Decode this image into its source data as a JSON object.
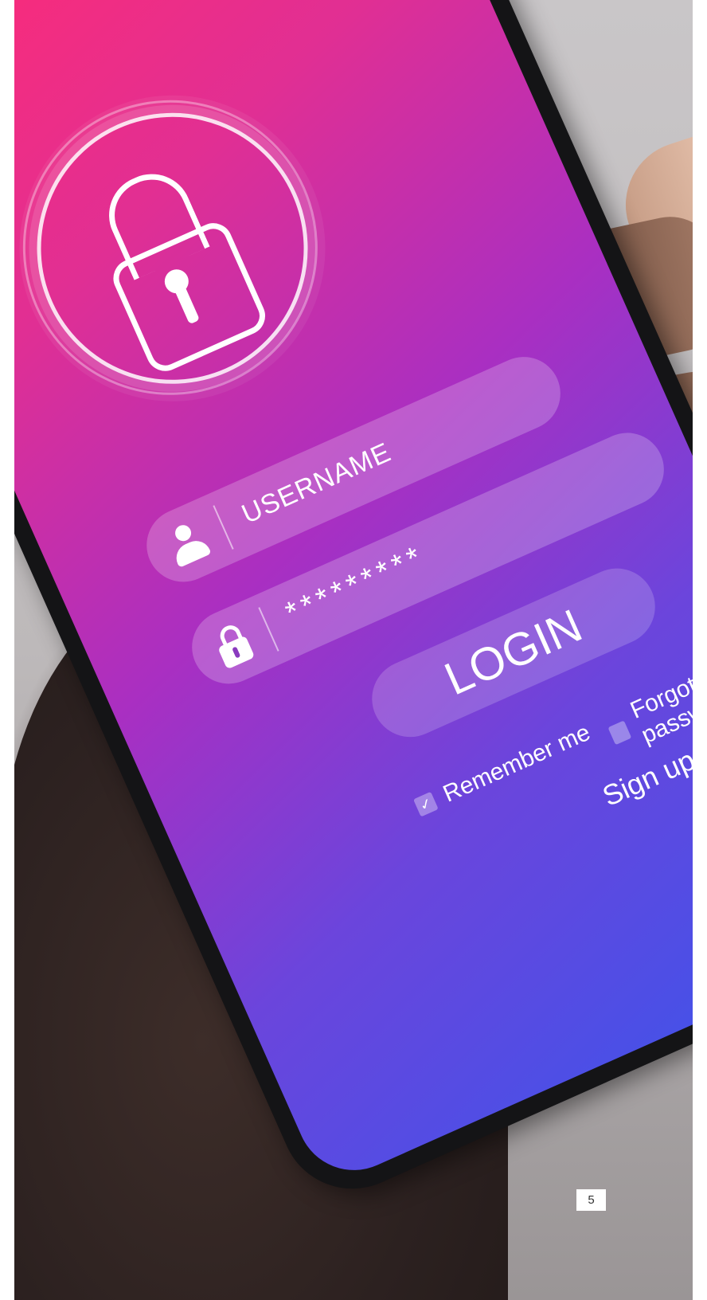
{
  "login_screen": {
    "lock_icon": "padlock-icon",
    "username_field": {
      "icon": "user-icon",
      "value": "USERNAME"
    },
    "password_field": {
      "icon": "padlock-icon",
      "value": "*********"
    },
    "login_button": "LOGIN",
    "remember_me": {
      "label": "Remember me",
      "checked": true
    },
    "forgot_password": {
      "label": "Forgot password",
      "checked": false
    },
    "sign_up": "Sign up"
  },
  "colors": {
    "gradient_top": "#ff2b74",
    "gradient_mid": "#a92fc2",
    "gradient_bottom": "#3f53ea"
  },
  "page_number": "5"
}
